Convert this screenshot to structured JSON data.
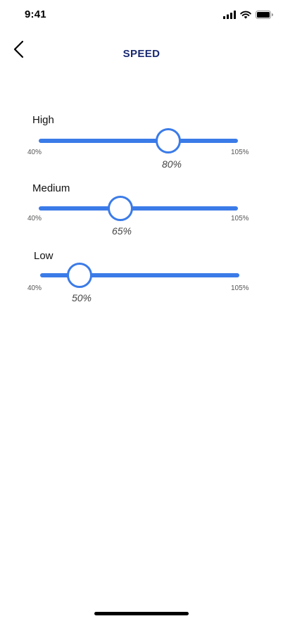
{
  "status_bar": {
    "time": "9:41",
    "icons": [
      "cellular-signal-icon",
      "wifi-icon",
      "battery-icon"
    ]
  },
  "header": {
    "title": "SPEED",
    "back_icon": "chevron-left-icon"
  },
  "colors": {
    "accent": "#3b7be8",
    "title": "#1a2a72"
  },
  "sliders": [
    {
      "label": "High",
      "min_label": "40%",
      "max_label": "105%",
      "value_label": "80%",
      "value": 80
    },
    {
      "label": "Medium",
      "min_label": "40%",
      "max_label": "105%",
      "value_label": "65%",
      "value": 65
    },
    {
      "label": "Low",
      "min_label": "40%",
      "max_label": "105%",
      "value_label": "50%",
      "value": 50
    }
  ]
}
